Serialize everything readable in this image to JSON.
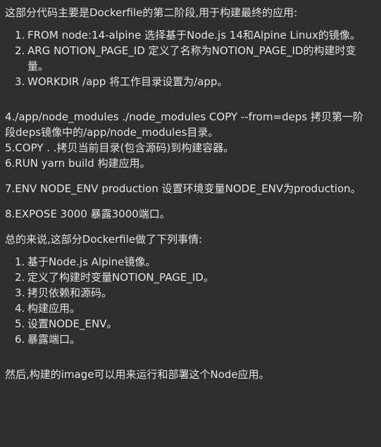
{
  "intro": "这部分代码主要是Dockerfile的第二阶段,用于构建最终的应用:",
  "list1": [
    {
      "num": "1.",
      "text": "FROM node:14-alpine 选择基于Node.js 14和Alpine Linux的镜像。"
    },
    {
      "num": "2.",
      "text": "ARG NOTION_PAGE_ID 定义了名称为NOTION_PAGE_ID的构建时变量。"
    },
    {
      "num": "3.",
      "text": "WORKDIR /app 将工作目录设置为/app。"
    }
  ],
  "block2": [
    "4./app/node_modules ./node_modules COPY --from=deps 拷贝第一阶段deps镜像中的/app/node_modules目录。",
    "5.COPY . .拷贝当前目录(包含源码)到构建容器。",
    "6.RUN yarn build 构建应用。"
  ],
  "p7": "7.ENV NODE_ENV production 设置环境变量NODE_ENV为production。",
  "p8": "8.EXPOSE 3000 暴露3000端口。",
  "summary": "总的来说,这部分Dockerfile做了下列事情:",
  "list2": [
    {
      "num": "1.",
      "text": "基于Node.js Alpine镜像。"
    },
    {
      "num": "2.",
      "text": "定义了构建时变量NOTION_PAGE_ID。"
    },
    {
      "num": "3.",
      "text": "拷贝依赖和源码。"
    },
    {
      "num": "4.",
      "text": "构建应用。"
    },
    {
      "num": "5.",
      "text": "设置NODE_ENV。"
    },
    {
      "num": "6.",
      "text": "暴露端口。"
    }
  ],
  "conclusion": "然后,构建的image可以用来运行和部署这个Node应用。"
}
